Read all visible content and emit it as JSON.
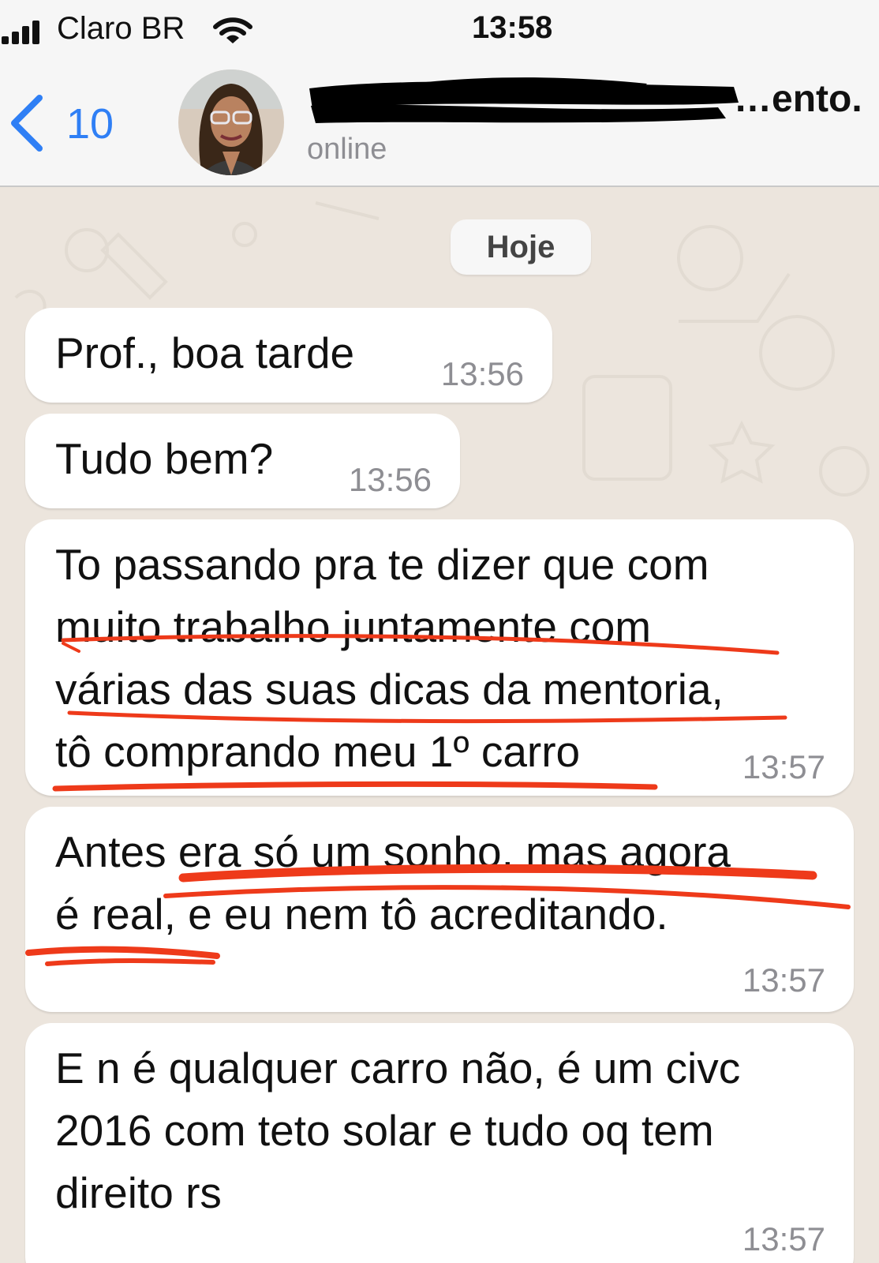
{
  "status_bar": {
    "carrier": "Claro BR",
    "time": "13:58"
  },
  "header": {
    "back_count": "10",
    "contact_name_visible_tail": "…ento.",
    "presence": "online"
  },
  "chat": {
    "date_separator": "Hoje",
    "messages": [
      {
        "text": "Prof., boa tarde",
        "time": "13:56"
      },
      {
        "text": "Tudo bem?",
        "time": "13:56"
      },
      {
        "text": "To passando pra te dizer que com\nmuito trabalho juntamente com\nvárias das suas dicas da mentoria,\ntô comprando meu 1º carro",
        "time": "13:57"
      },
      {
        "text": "Antes era só um sonho, mas agora\né real, e eu nem tô acreditando.",
        "time": "13:57"
      },
      {
        "text": "E n é qualquer carro não, é um civc\n2016 com teto solar e tudo oq tem\ndireito rs",
        "time": "13:57"
      }
    ]
  },
  "colors": {
    "accent_blue": "#2f7ff5",
    "annotation_red": "#ee3a1a",
    "wallpaper": "#ece5dd",
    "bubble_incoming": "#ffffff"
  },
  "icons": [
    "cellular-signal-icon",
    "wifi-icon",
    "back-chevron-icon",
    "contact-avatar"
  ]
}
